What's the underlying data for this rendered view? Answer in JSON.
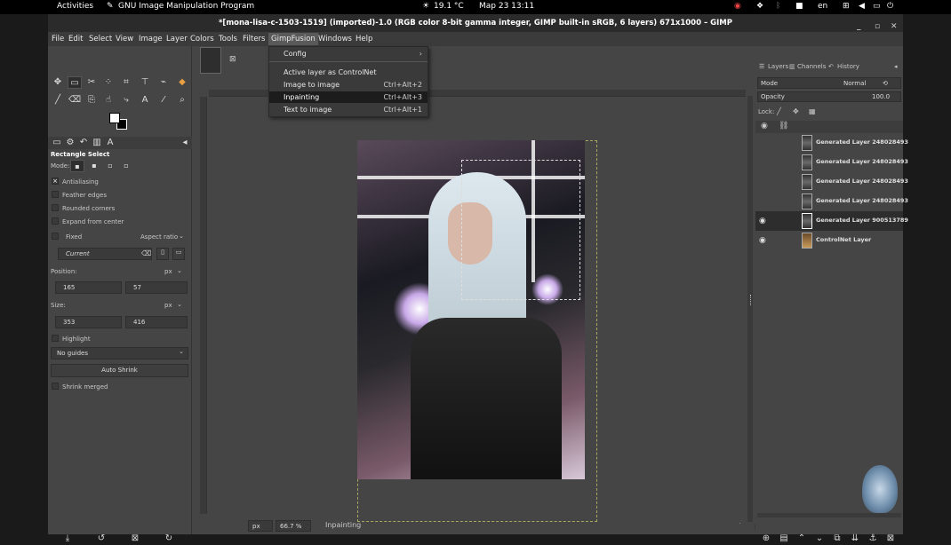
{
  "topbar": {
    "activities": "Activities",
    "app_name": "GNU Image Manipulation Program",
    "weather": "19.1 °C",
    "clock": "Мар 23  13:11",
    "lang": "en"
  },
  "window": {
    "title": "*[mona-lisa-c-1503-1519] (imported)-1.0 (RGB color 8-bit gamma integer, GIMP built-in sRGB, 6 layers) 671x1000 – GIMP"
  },
  "menubar": [
    "File",
    "Edit",
    "Select",
    "View",
    "Image",
    "Layer",
    "Colors",
    "Tools",
    "Filters",
    "GimpFusion",
    "Windows",
    "Help"
  ],
  "dropdown": {
    "items": [
      {
        "label": "Config",
        "shortcut": "",
        "submenu": true
      },
      {
        "label": "Active layer as ControlNet",
        "shortcut": ""
      },
      {
        "label": "Image to image",
        "shortcut": "Ctrl+Alt+2"
      },
      {
        "label": "Inpainting",
        "shortcut": "Ctrl+Alt+3"
      },
      {
        "label": "Text to image",
        "shortcut": "Ctrl+Alt+1"
      }
    ]
  },
  "tool_options": {
    "title": "Rectangle Select",
    "mode_label": "Mode:",
    "antialiasing": "Antialiasing",
    "feather_edges": "Feather edges",
    "rounded_corners": "Rounded corners",
    "expand_from_center": "Expand from center",
    "fixed": "Fixed",
    "fixed_option": "Aspect ratio",
    "current": "Current",
    "position_label": "Position:",
    "position_unit": "px",
    "pos_x": "165",
    "pos_y": "57",
    "size_label": "Size:",
    "size_unit": "px",
    "size_w": "353",
    "size_h": "416",
    "highlight": "Highlight",
    "guides": "No guides",
    "auto_shrink": "Auto Shrink",
    "shrink_merged": "Shrink merged"
  },
  "layers_panel": {
    "tabs": [
      "Layers",
      "Channels",
      "History"
    ],
    "mode_label": "Mode",
    "mode_value": "Normal",
    "opacity_label": "Opacity",
    "opacity_value": "100.0",
    "lock_label": "Lock:",
    "layers": [
      {
        "name": "Generated Layer 248028493",
        "visible": false
      },
      {
        "name": "Generated Layer 248028493",
        "visible": false
      },
      {
        "name": "Generated Layer 248028493",
        "visible": false
      },
      {
        "name": "Generated Layer 248028493",
        "visible": false
      },
      {
        "name": "Generated Layer 900513789",
        "visible": true
      },
      {
        "name": "ControlNet Layer",
        "visible": true
      }
    ]
  },
  "status": {
    "unit": "px",
    "zoom": "66.7 %",
    "message": "Inpainting"
  },
  "colors": {
    "accent": "#ffffff",
    "selection": "#d0d0a0"
  }
}
